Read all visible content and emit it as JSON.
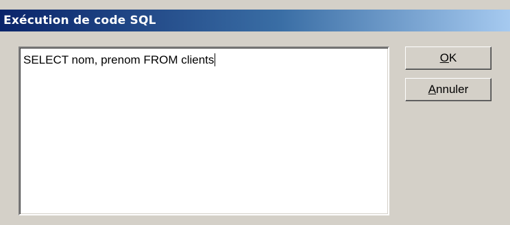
{
  "dialog": {
    "title": "Exécution de code SQL",
    "sql_text": "SELECT nom, prenom FROM clients",
    "ok_button": {
      "accel": "O",
      "rest": "K"
    },
    "cancel_button": {
      "accel": "A",
      "rest": "nnuler"
    }
  },
  "colors": {
    "face": "#d4d0c8",
    "title_start": "#0a246a",
    "title_end": "#a6caf0"
  }
}
